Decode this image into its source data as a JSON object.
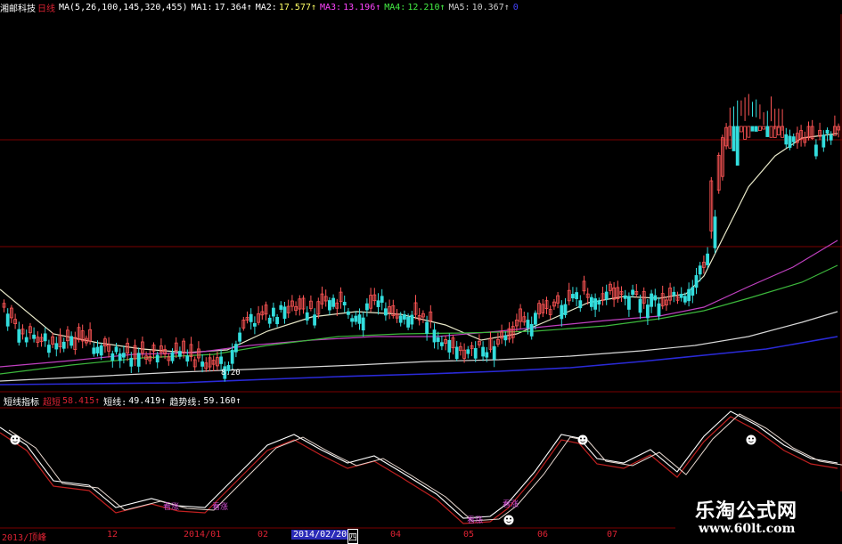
{
  "header": {
    "stock_name": "湘邮科技",
    "period": "日线",
    "ma_params": "MA(5,26,100,145,320,455)",
    "ma1": {
      "label": "MA1:",
      "value": "17.364",
      "arrow": "↑",
      "color": "#ffffff"
    },
    "ma2": {
      "label": "MA2:",
      "value": "17.577",
      "arrow": "↑",
      "color": "#ffff66"
    },
    "ma3": {
      "label": "MA3:",
      "value": "13.196",
      "arrow": "↑",
      "color": "#ff44ff"
    },
    "ma4": {
      "label": "MA4:",
      "value": "12.210",
      "arrow": "↑",
      "color": "#44ee44"
    },
    "ma5": {
      "label": "MA5:",
      "value": "10.367",
      "arrow": "↑",
      "color": "#cccccc"
    },
    "ma6_marker": "0"
  },
  "price_chart": {
    "low_marker": "8.20",
    "colors": {
      "up": "#ff5555",
      "down": "#33dddd",
      "ma1": "#ffffff",
      "ma2": "#e8e8c8",
      "ma3": "#c040c0",
      "ma4": "#3cb83c",
      "ma5": "#d8d8d8",
      "ma6": "#2a2ad8",
      "grid": "#7a0000"
    }
  },
  "indicator": {
    "name": "短线指标",
    "ultra_label": "超短",
    "ultra_value": "58.415↑",
    "short_label": "短线:",
    "short_value": "49.419↑",
    "trend_label": "趋势线:",
    "trend_value": "59.160↑",
    "buy_tags": [
      "看涨",
      "看涨",
      "看涨",
      "看涨"
    ]
  },
  "x_axis": {
    "labels": [
      "2013/顶峰",
      "12",
      "2014/01",
      "02",
      "2014/02/20",
      "四",
      "04",
      "05",
      "06",
      "07"
    ],
    "highlighted": "2014/02/20"
  },
  "watermark": {
    "title": "乐淘公式网",
    "url": "www.60lt.com"
  }
}
